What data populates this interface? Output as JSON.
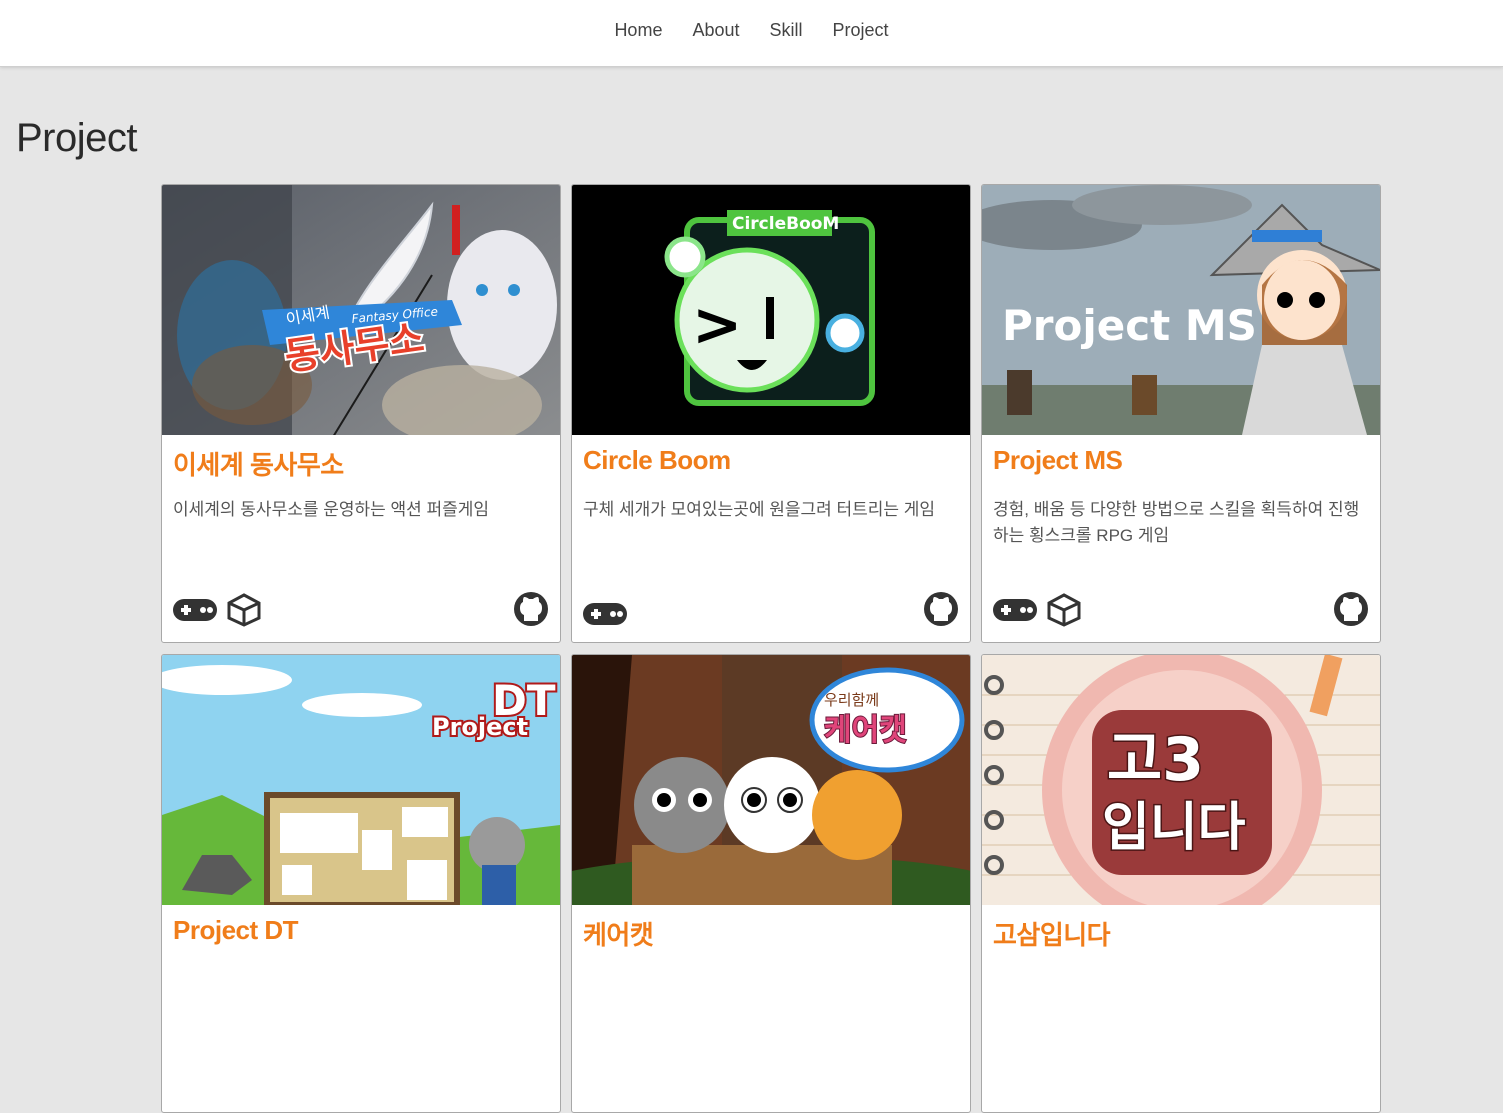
{
  "nav": {
    "items": [
      "Home",
      "About",
      "Skill",
      "Project"
    ]
  },
  "page": {
    "title": "Project"
  },
  "projects": [
    {
      "title": "이세계 동사무소",
      "description": "이세계의 동사무소를 운영하는 액션 퍼즐게임",
      "thumb_text": "이세계 동사무소 Fantasy Office",
      "icons": [
        "gamepad-icon",
        "unity-icon"
      ],
      "repo_icon": "github-icon"
    },
    {
      "title": "Circle Boom",
      "description": "구체 세개가 모여있는곳에 원을그려 터트리는 게임",
      "thumb_text": "CircleBooM",
      "icons": [
        "gamepad-icon"
      ],
      "repo_icon": "github-icon"
    },
    {
      "title": "Project MS",
      "description": "경험, 배움 등 다양한 방법으로 스킬을 획득하여 진행하는 횡스크롤 RPG 게임",
      "thumb_text": "Project MS",
      "icons": [
        "gamepad-icon",
        "unity-icon"
      ],
      "repo_icon": "github-icon"
    },
    {
      "title": "Project DT",
      "description": "",
      "thumb_text": "Project DT",
      "icons": [],
      "repo_icon": ""
    },
    {
      "title": "케어캣",
      "description": "",
      "thumb_text": "우리함께 케어캣",
      "icons": [],
      "repo_icon": ""
    },
    {
      "title": "고삼입니다",
      "description": "",
      "thumb_text": "고3 입니다",
      "icons": [],
      "repo_icon": ""
    }
  ],
  "colors": {
    "accent": "#f07d1a",
    "background": "#e6e6e6",
    "nav_background": "#ffffff"
  }
}
